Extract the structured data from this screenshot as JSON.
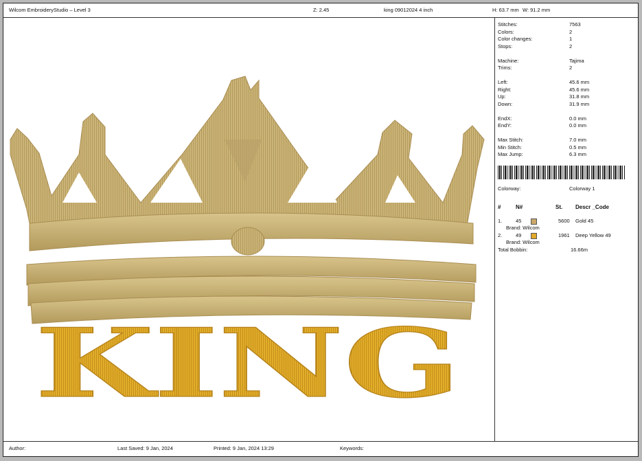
{
  "header": {
    "app_title": "Wilcom EmbroideryStudio – Level 3",
    "zoom": "Z: 2.45",
    "file_name": "king 09012024 4 inch",
    "height": "H: 63.7 mm",
    "width": "W: 91.2 mm"
  },
  "design": {
    "label": "KING"
  },
  "stats": [
    {
      "key": "Stitches:",
      "value": "7563"
    },
    {
      "key": "Colors:",
      "value": "2"
    },
    {
      "key": "Color changes:",
      "value": "1"
    },
    {
      "key": "Stops:",
      "value": "2"
    },
    {
      "key": "Machine:",
      "value": "Tajima"
    },
    {
      "key": "Trims:",
      "value": "2"
    },
    {
      "key": "Left:",
      "value": "45.6 mm"
    },
    {
      "key": "Right:",
      "value": "45.6 mm"
    },
    {
      "key": "Up:",
      "value": "31.8 mm"
    },
    {
      "key": "Down:",
      "value": "31.9 mm"
    },
    {
      "key": "EndX:",
      "value": "0.0 mm"
    },
    {
      "key": "EndY:",
      "value": "0.0 mm"
    },
    {
      "key": "Max Stitch:",
      "value": "7.0 mm"
    },
    {
      "key": "Min Stitch:",
      "value": "0.5 mm"
    },
    {
      "key": "Max Jump:",
      "value": "6.3 mm"
    }
  ],
  "colorway": {
    "key": "Colorway:",
    "value": "Colorway 1"
  },
  "thread_table": {
    "headers": {
      "num": "#",
      "n": "N#",
      "st": "St.",
      "descr": "Descr _Code"
    },
    "rows": [
      {
        "idx": "1.",
        "n": "45",
        "st": "5600",
        "descr": "Gold 45",
        "brand": "Brand: Wilcom",
        "color": "#c9a86a"
      },
      {
        "idx": "2.",
        "n": "49",
        "st": "1961",
        "descr": "Deep Yellow 49",
        "brand": "Brand: Wilcom",
        "color": "#e3a92a"
      }
    ],
    "total_bobbin_label": "Total Bobbin:",
    "total_bobbin_value": "16.66m"
  },
  "footer": {
    "author": "Author:",
    "last_saved": "Last Saved:  9 Jan, 2024",
    "printed": "Printed:  9 Jan, 2024 13:29",
    "keywords": "Keywords:"
  }
}
